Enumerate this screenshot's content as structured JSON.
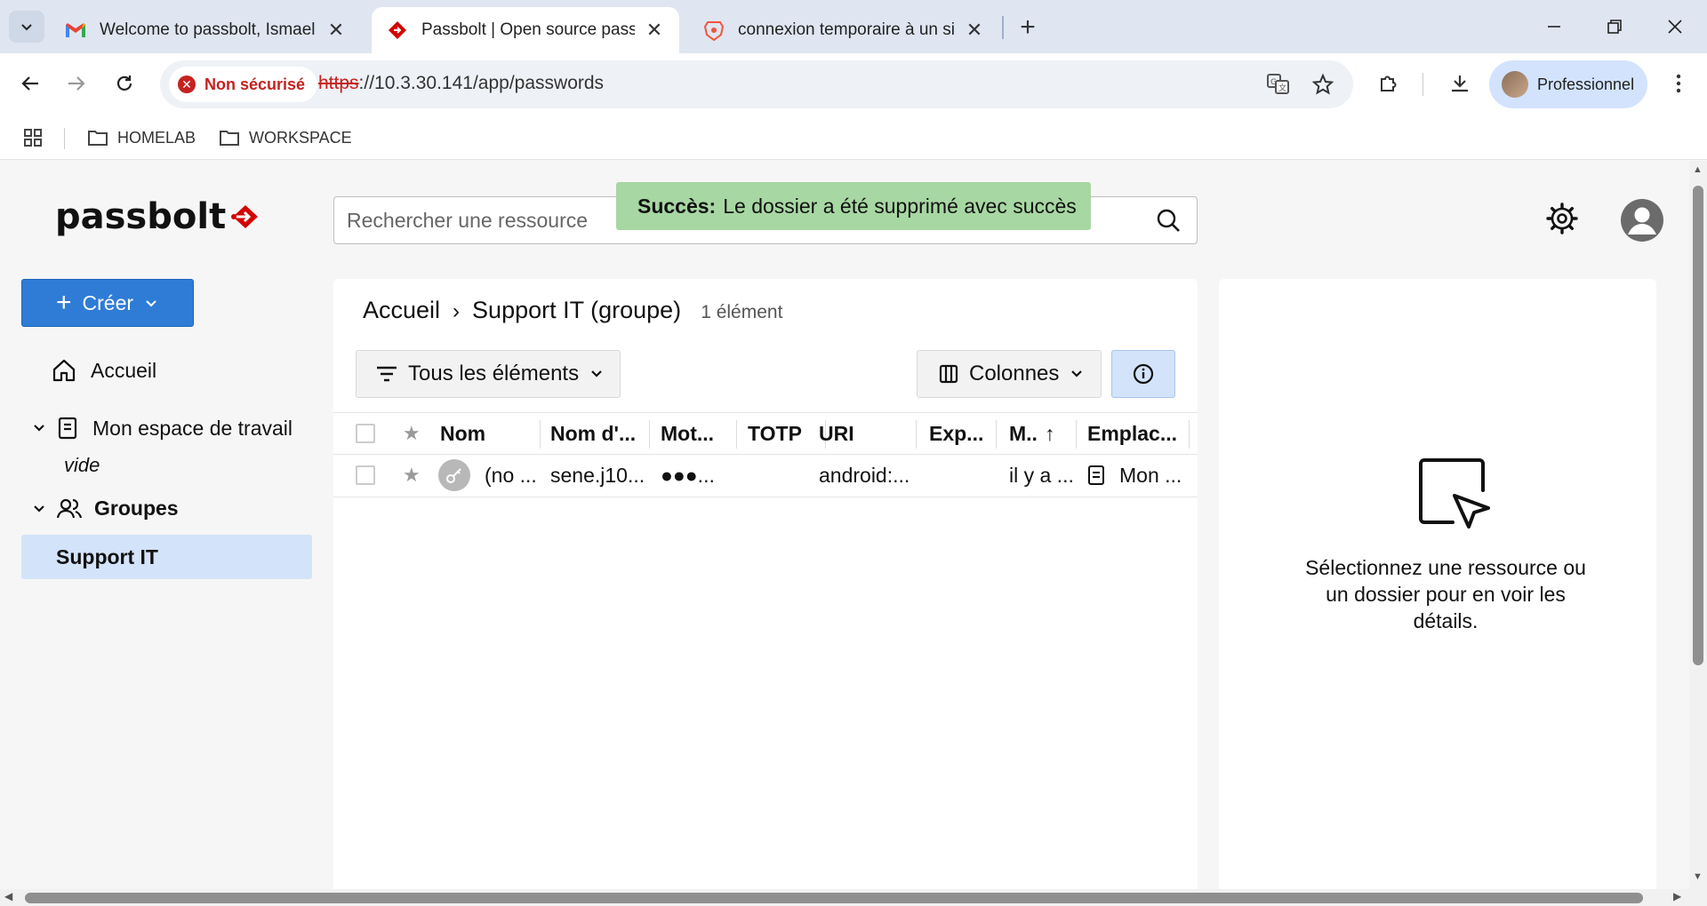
{
  "browser": {
    "tabs": [
      {
        "title": "Welcome to passbolt, Ismael! -",
        "icon": "gmail-icon"
      },
      {
        "title": "Passbolt | Open source passwor",
        "icon": "passbolt-icon",
        "active": true
      },
      {
        "title": "connexion temporaire à un site",
        "icon": "brave-icon"
      }
    ],
    "security_label": "Non sécurisé",
    "url_scheme": "https",
    "url_rest": "://10.3.30.141/app/passwords",
    "profile_label": "Professionnel",
    "bookmarks": [
      "HOMELAB",
      "WORKSPACE"
    ]
  },
  "app": {
    "logo_text": "passbolt",
    "search_placeholder": "Rechercher une ressource",
    "toast": {
      "title": "Succès:",
      "message": "Le dossier a été supprimé avec succès"
    },
    "create_label": "Créer",
    "sidebar": {
      "home": "Accueil",
      "workspace": "Mon espace de travail",
      "workspace_empty": "vide",
      "groups": "Groupes",
      "selected_group": "Support IT"
    },
    "breadcrumb": {
      "root": "Accueil",
      "separator": "›",
      "current": "Support IT (groupe)",
      "count": "1 élément"
    },
    "filter_label": "Tous les éléments",
    "columns_label": "Colonnes",
    "grid": {
      "headers": [
        "Nom",
        "Nom d'...",
        "Mot...",
        "TOTP",
        "URI",
        "Exp...",
        "M..",
        "Emplac..."
      ],
      "sort_indicator": "↑",
      "rows": [
        {
          "name": "(no ...",
          "username": "sene.j10...",
          "password": "●●●...",
          "totp": "",
          "uri": "android:...",
          "expiry": "",
          "modified": "il y a ...",
          "location": "Mon ..."
        }
      ]
    },
    "details_hint": "Sélectionnez une ressource ou un dossier pour en voir les détails.",
    "colors": {
      "primary": "#2f7cd6",
      "toast_bg": "#a7d7a2",
      "selected_bg": "#d3e3fa",
      "brand_red": "#d40101"
    }
  }
}
